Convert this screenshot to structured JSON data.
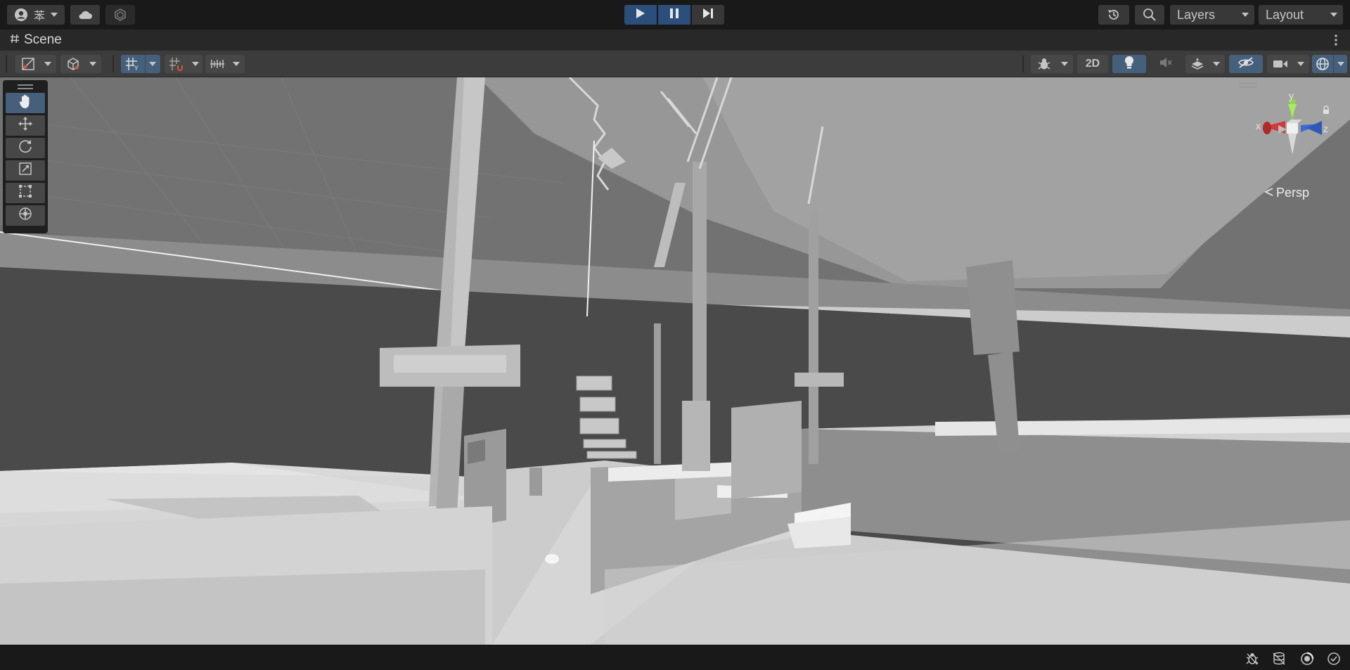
{
  "topbar": {
    "account_initial": "苯",
    "layers_label": "Layers",
    "layout_label": "Layout"
  },
  "scene_tab": {
    "title": "Scene"
  },
  "scene_toolbar": {
    "mode_2d_label": "2D"
  },
  "gizmo": {
    "axis_x": "x",
    "axis_y": "y",
    "axis_z": "z",
    "projection_label": "Persp"
  },
  "colors": {
    "accent_blue": "#46607c",
    "play_blue": "#2b4f7a",
    "axis_x": "#d23a3a",
    "axis_y": "#8ed64a",
    "axis_z": "#3a6bd2"
  }
}
